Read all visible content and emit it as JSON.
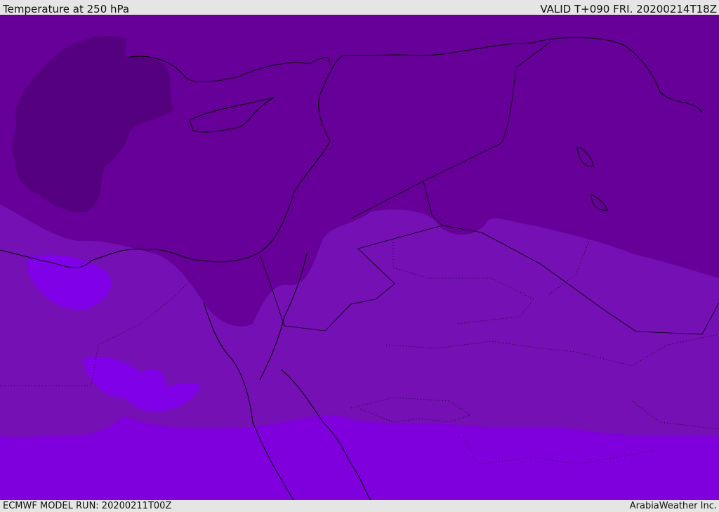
{
  "header": {
    "title": "Temperature at 250 hPa",
    "valid": "VALID T+090 FRI. 20200214T18Z"
  },
  "footer": {
    "model_run": "ECMWF MODEL RUN: 20200211T00Z",
    "credit": "ArabiaWeather Inc."
  },
  "map": {
    "variable": "temperature",
    "level_hpa": 250,
    "colors": {
      "coldest": "#55007f",
      "cold": "#660099",
      "mid": "#7510b5",
      "warm": "#7f00dd",
      "warm_blob": "#8000e8",
      "coastline": "#000000"
    }
  }
}
